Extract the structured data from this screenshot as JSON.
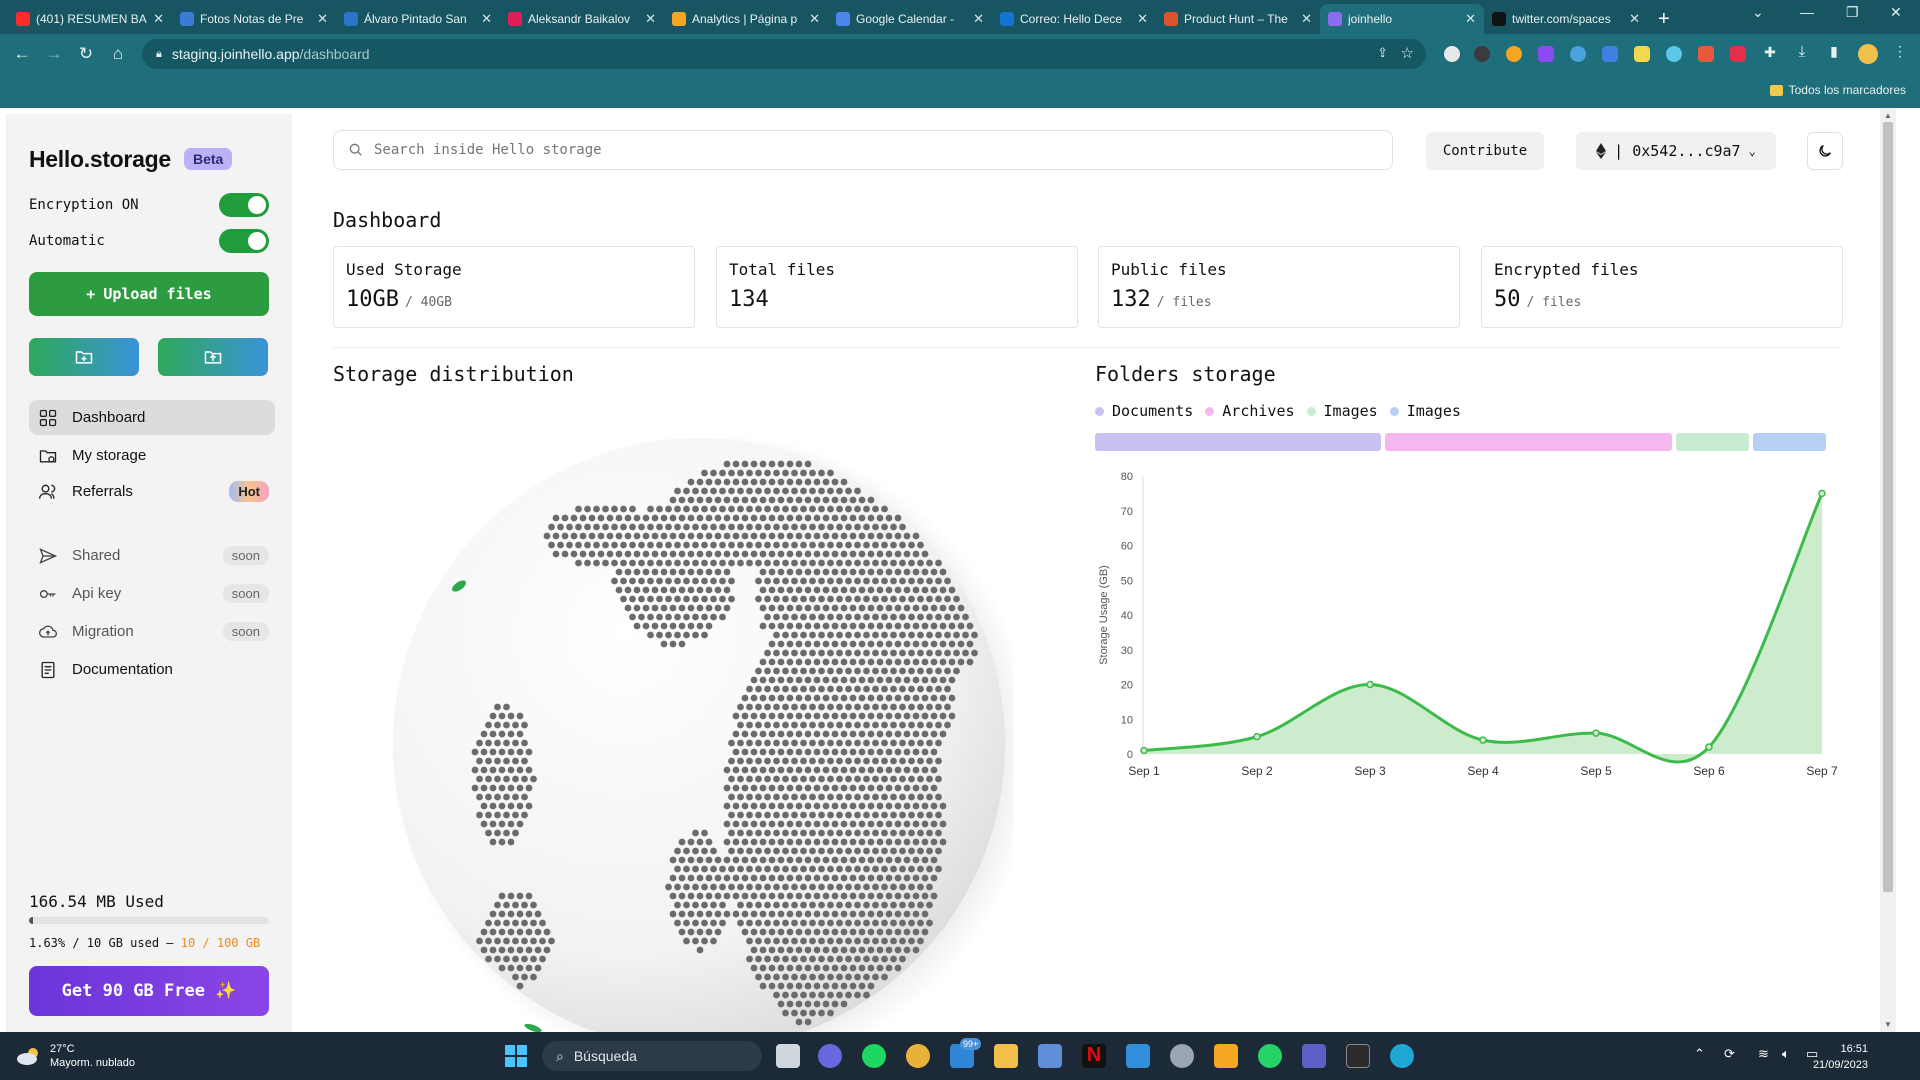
{
  "browser": {
    "tabs": [
      {
        "label": "(401) RESUMEN BA",
        "icon": "youtube-icon",
        "color": "#ff2a2a"
      },
      {
        "label": "Fotos Notas de Pre",
        "icon": "site-icon",
        "color": "#3b7bd6"
      },
      {
        "label": "Álvaro Pintado San",
        "icon": "linkedin-icon",
        "color": "#2a74c9"
      },
      {
        "label": "Aleksandr Baikalov",
        "icon": "slack-icon",
        "color": "#e01e5a"
      },
      {
        "label": "Analytics | Página p",
        "icon": "analytics-icon",
        "color": "#f5a623"
      },
      {
        "label": "Google Calendar -",
        "icon": "calendar-icon",
        "color": "#4a86e8"
      },
      {
        "label": "Correo: Hello Dece",
        "icon": "outlook-icon",
        "color": "#1474d4"
      },
      {
        "label": "Product Hunt – The",
        "icon": "producthunt-icon",
        "color": "#da552f"
      },
      {
        "label": "joinhello",
        "icon": "hello-icon",
        "color": "#8a6df0"
      },
      {
        "label": "twitter.com/spaces",
        "icon": "x-icon",
        "color": "#111111"
      }
    ],
    "active_tab": 8,
    "url_host": "staging.joinhello.app",
    "url_path": "/dashboard",
    "bookmarks_label": "Todos los marcadores"
  },
  "sidebar": {
    "logo": "Hello.storage",
    "beta": "Beta",
    "encryption_label": "Encryption ON",
    "automatic_label": "Automatic",
    "upload_label": "Upload files",
    "nav": [
      {
        "label": "Dashboard",
        "icon": "dashboard-icon",
        "badge": ""
      },
      {
        "label": "My storage",
        "icon": "storage-icon",
        "badge": ""
      },
      {
        "label": "Referrals",
        "icon": "referrals-icon",
        "badge": "Hot"
      }
    ],
    "nav2": [
      {
        "label": "Shared",
        "icon": "shared-icon",
        "badge": "soon"
      },
      {
        "label": "Api key",
        "icon": "key-icon",
        "badge": "soon"
      },
      {
        "label": "Migration",
        "icon": "cloud-upload-icon",
        "badge": "soon"
      },
      {
        "label": "Documentation",
        "icon": "docs-icon",
        "badge": ""
      }
    ],
    "used_title": "166.54 MB Used",
    "used_fraction": 0.0163,
    "used_sub_a": "1.63% / 10 GB used –",
    "used_sub_b": "10 / 100 GB",
    "get_free": "Get 90 GB Free ✨"
  },
  "header": {
    "search_placeholder": "Search inside Hello storage",
    "contribute": "Contribute",
    "wallet": "| 0x542...c9a7"
  },
  "dashboard": {
    "title": "Dashboard",
    "cards": [
      {
        "title": "Used Storage",
        "value": "10GB",
        "unit": "/ 40GB"
      },
      {
        "title": "Total files",
        "value": "134",
        "unit": ""
      },
      {
        "title": "Public files",
        "value": "132",
        "unit": "/ files"
      },
      {
        "title": "Encrypted files",
        "value": "50",
        "unit": "/ files"
      }
    ],
    "distribution_title": "Storage distribution",
    "folders_title": "Folders storage",
    "folders_legend": [
      {
        "label": "Documents",
        "color": "#c9c1f0",
        "share": 0.39
      },
      {
        "label": "Archives",
        "color": "#f4b8ef",
        "share": 0.39
      },
      {
        "label": "Images",
        "color": "#c8ecd2",
        "share": 0.1
      },
      {
        "label": "Images",
        "color": "#b8cff5",
        "share": 0.1
      }
    ]
  },
  "chart_data": {
    "type": "area",
    "x": [
      "Sep 1",
      "Sep 2",
      "Sep 3",
      "Sep 4",
      "Sep 5",
      "Sep 6",
      "Sep 7"
    ],
    "series": [
      {
        "values": [
          1,
          5,
          20,
          4,
          6,
          2,
          75
        ]
      }
    ],
    "ylabel": "Storage Usage (GB)",
    "ylim": [
      0,
      80
    ],
    "yticks": [
      0,
      10,
      20,
      30,
      40,
      50,
      60,
      70,
      80
    ],
    "color": "#3dbb4a",
    "fill": "#cdeccd"
  },
  "taskbar": {
    "temp": "27°C",
    "weather": "Mayorm. nublado",
    "search": "Búsqueda",
    "time": "16:51",
    "date": "21/09/2023",
    "mail_badge": "99+"
  }
}
